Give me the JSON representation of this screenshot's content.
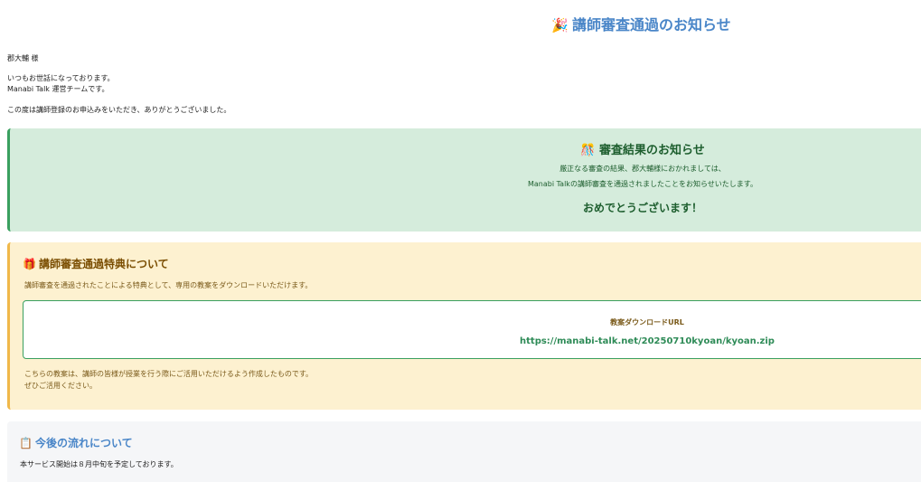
{
  "header": {
    "icon": "party-popper-icon",
    "icon_glyph": "🎉",
    "title": "講師審査通過のお知らせ"
  },
  "greeting": {
    "recipient": "郡大輔 様",
    "line1": "いつもお世話になっております。",
    "line2": "Manabi Talk 運営チームです。",
    "line3": "この度は講師登録のお申込みをいただき、ありがとうございました。"
  },
  "result_notice": {
    "icon": "confetti-ball-icon",
    "icon_glyph": "🎊",
    "title": "審査結果のお知らせ",
    "line1": "厳正なる審査の結果、郡大輔様におかれましては、",
    "line2": "Manabi Talkの講師審査を通過されましたことをお知らせいたします。",
    "congrats": "おめでとうございます！"
  },
  "benefit": {
    "icon": "gift-icon",
    "icon_glyph": "🎁",
    "title": "講師審査通過特典について",
    "description": "講師審査を通過されたことによる特典として、専用の教案をダウンロードいただけます。",
    "download_label": "教案ダウンロードURL",
    "download_url": "https://manabi-talk.net/20250710kyoan/kyoan.zip",
    "note1": "こちらの教案は、講師の皆様が授業を行う際にご活用いただけるよう作成したものです。",
    "note2": "ぜひご活用ください。"
  },
  "next_steps": {
    "icon": "clipboard-icon",
    "icon_glyph": "📋",
    "title": "今後の流れについて",
    "text": "本サービス開始は８月中旬を予定しております。"
  },
  "colors": {
    "title_blue": "#4a86c8",
    "success_bg": "#d5ecdc",
    "success_border": "#3aa060",
    "warning_bg": "#fdf1d0",
    "warning_border": "#f0b84a",
    "link_green": "#2e8b57"
  }
}
